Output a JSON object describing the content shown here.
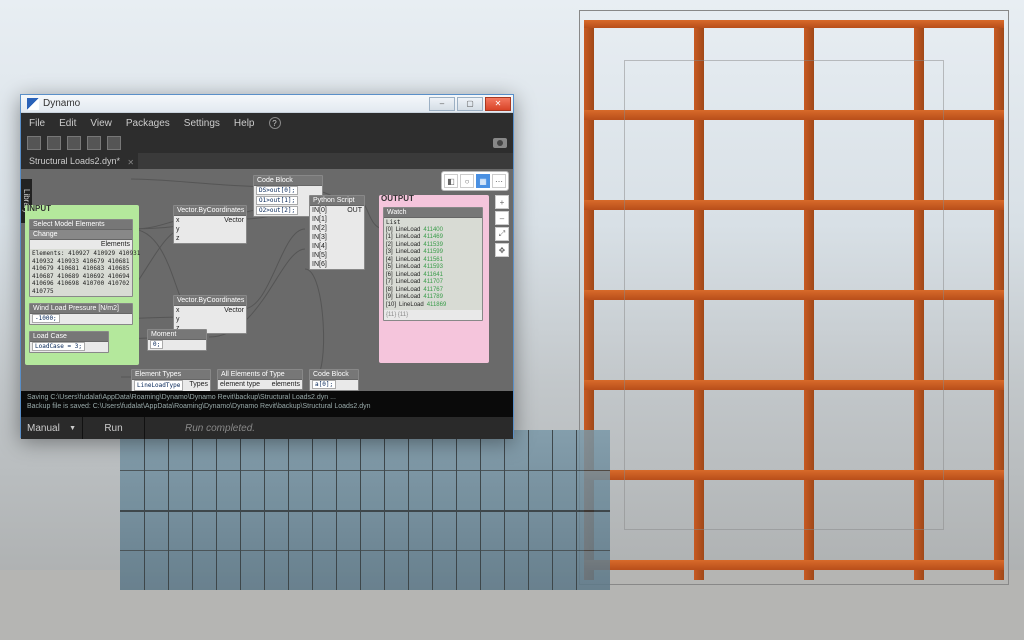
{
  "title": "Dynamo",
  "titlebar": {
    "minimize": "–",
    "maximize": "▢",
    "close": "✕"
  },
  "menu": [
    "File",
    "Edit",
    "View",
    "Packages",
    "Settings",
    "Help"
  ],
  "tab": {
    "name": "Structural Loads2.dyn*",
    "close": "✕"
  },
  "library_tab": "Library",
  "view_controls": {
    "zoom_in": "+",
    "zoom_out": "–",
    "fit": "⤢",
    "pan": "✥"
  },
  "groups": {
    "input": "INPUT",
    "output": "OUTPUT"
  },
  "nodes": {
    "select_elements": {
      "title": "Select Model Elements",
      "sub": "Change",
      "out": "Elements",
      "list": "Elements: 410927 410929 410931\n410932 410933 410679 410681\n410679 410681 410683 410685\n410687 410689 410692 410694\n410696 410698 410700 410702\n410775"
    },
    "wind": {
      "title": "Wind Load Pressure [N/m2]",
      "value": "-1000;"
    },
    "loadcase": {
      "title": "Load Case",
      "value": "LoadCase = 3;"
    },
    "etypes": {
      "title": "Element Types",
      "value": "LineLoadType",
      "out": "Types"
    },
    "allof": {
      "title": "All Elements of Type",
      "in": "element type",
      "out": "elements"
    },
    "cb2": {
      "title": "Code Block",
      "value": "a[0];"
    },
    "vec1": {
      "title": "Vector.ByCoordinates",
      "ports": [
        "x",
        "y",
        "z"
      ],
      "out": "Vector"
    },
    "vec2": {
      "title": "Vector.ByCoordinates",
      "ports": [
        "x",
        "y",
        "z"
      ],
      "out": "Vector"
    },
    "moment": {
      "title": "Moment",
      "value": "0;"
    },
    "cb1": {
      "title": "Code Block",
      "lines": [
        "DS>out[0];",
        "O1>out[1];",
        "O2>out[2];"
      ]
    },
    "python": {
      "title": "Python Script",
      "ins": [
        "IN[0]",
        "IN[1]",
        "IN[2]",
        "IN[3]",
        "IN[4]",
        "IN[5]",
        "IN[6]"
      ],
      "out": "OUT"
    },
    "watch": {
      "title": "Watch",
      "rows": [
        [
          "[0]",
          "LineLoad",
          "411400"
        ],
        [
          "[1]",
          "LineLoad",
          "411469"
        ],
        [
          "[2]",
          "LineLoad",
          "411539"
        ],
        [
          "[3]",
          "LineLoad",
          "411599"
        ],
        [
          "[4]",
          "LineLoad",
          "411561"
        ],
        [
          "[5]",
          "LineLoad",
          "411593"
        ],
        [
          "[6]",
          "LineLoad",
          "411641"
        ],
        [
          "[7]",
          "LineLoad",
          "411707"
        ],
        [
          "[8]",
          "LineLoad",
          "411767"
        ],
        [
          "[9]",
          "LineLoad",
          "411789"
        ],
        [
          "[10]",
          "LineLoad",
          "411869"
        ]
      ],
      "footer": "{11} {11}"
    }
  },
  "console": {
    "l1": "Saving C:\\Users\\fudalat\\AppData\\Roaming\\Dynamo\\Dynamo Revit\\backup\\Structural Loads2.dyn ...",
    "l2": "Backup file is saved: C:\\Users\\fudalat\\AppData\\Roaming\\Dynamo\\Dynamo Revit\\backup\\Structural Loads2.dyn"
  },
  "runbar": {
    "mode": "Manual",
    "run": "Run",
    "status": "Run completed."
  }
}
